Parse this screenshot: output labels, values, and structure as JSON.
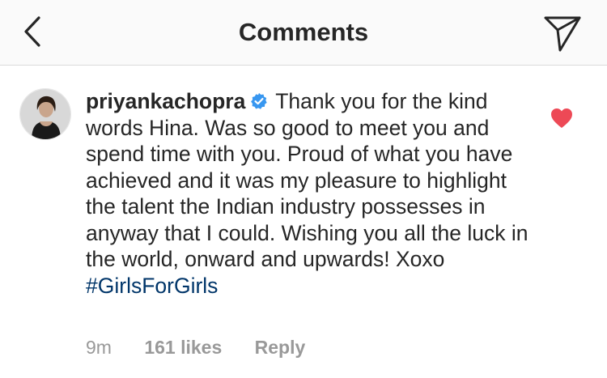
{
  "header": {
    "title": "Comments",
    "back_icon": "chevron-left-icon",
    "share_icon": "direct-send-icon"
  },
  "comment": {
    "username": "priyankachopra",
    "verified": true,
    "text": " Thank you for the kind words Hina. Was so good to meet you and spend time with you. Proud of what you have achieved and it was my pleasure to highlight the talent the Indian industry possesses in anyway that I could. Wishing you all the luck in the world, onward and upwards! Xoxo ",
    "hashtag": "#GirlsForGirls",
    "liked": true,
    "time": "9m",
    "likes": "161 likes",
    "reply_label": "Reply"
  },
  "colors": {
    "header_bg": "#fafafa",
    "text": "#262626",
    "meta": "#999999",
    "hashtag": "#003569",
    "verified_badge": "#3897f0",
    "heart": "#ed4956"
  }
}
